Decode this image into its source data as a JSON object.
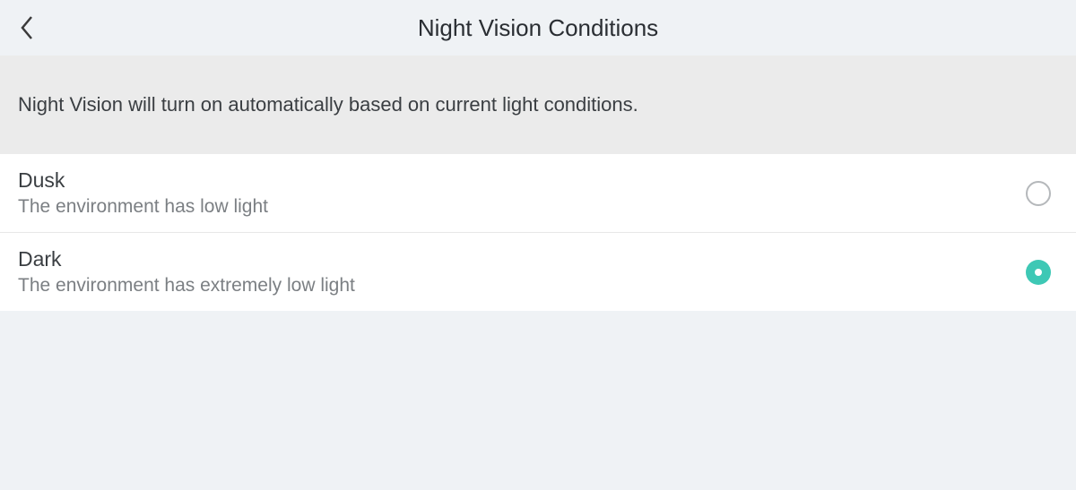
{
  "header": {
    "title": "Night Vision Conditions"
  },
  "description": "Night Vision will turn on automatically based on current light conditions.",
  "options": [
    {
      "title": "Dusk",
      "subtitle": "The environment has low light",
      "selected": false
    },
    {
      "title": "Dark",
      "subtitle": "The environment has extremely low light",
      "selected": true
    }
  ]
}
